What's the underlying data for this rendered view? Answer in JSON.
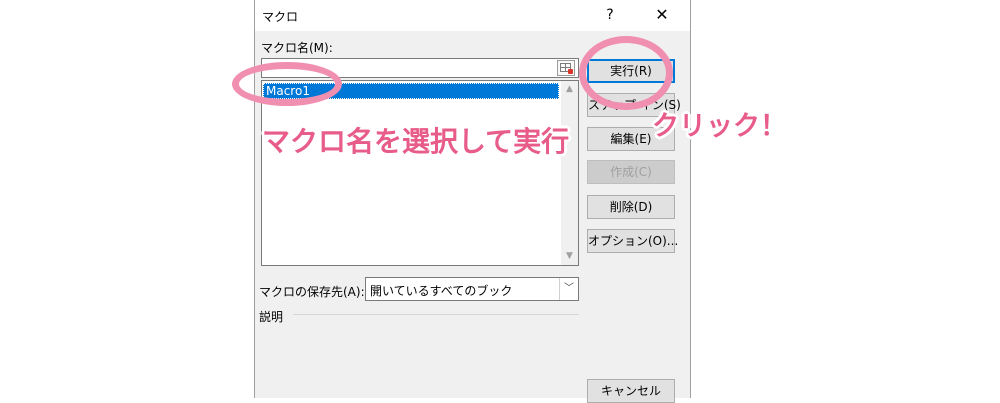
{
  "dialog": {
    "title": "マクロ",
    "help_label": "?",
    "close_label": "✕",
    "macro_name_label": "マクロ名(M):",
    "macro_name_value": "",
    "macros": [
      "Macro1"
    ],
    "buttons": {
      "run": "実行(R)",
      "step": "ステップ イン(S)",
      "edit": "編集(E)",
      "create": "作成(C)",
      "delete": "削除(D)",
      "options": "オプション(O)...",
      "cancel": "キャンセル"
    },
    "store_label": "マクロの保存先(A):",
    "store_value": "開いているすべてのブック",
    "description_label": "説明"
  },
  "annotations": {
    "select_instruction": "マクロ名を選択して実行",
    "click_instruction": "クリック！",
    "highlight_color": "#f08fb0",
    "text_color": "#e85c8a"
  }
}
